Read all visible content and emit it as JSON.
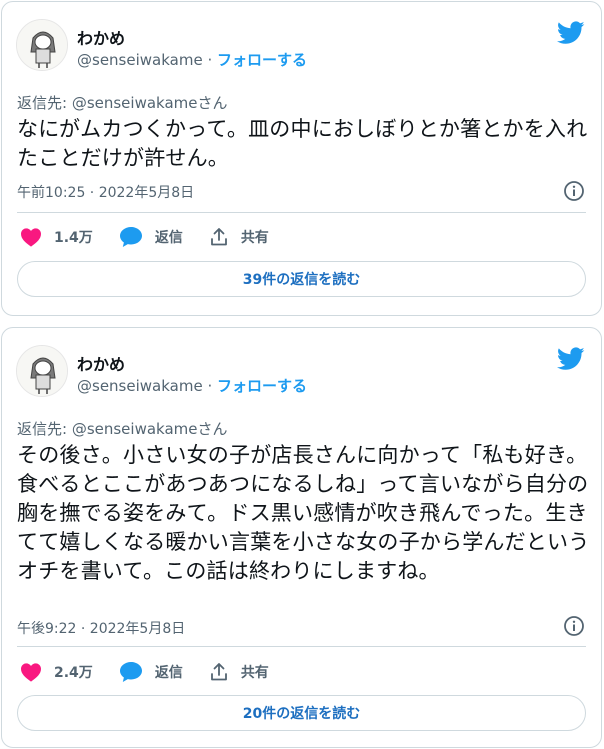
{
  "colors": {
    "accent": "#1d9bf0",
    "like": "#f91880",
    "muted": "#536471"
  },
  "tweets": [
    {
      "name": "わかめ",
      "handle": "@senseiwakame",
      "separator": " · ",
      "follow_label": "フォローする",
      "reply_to": "返信先: @senseiwakameさん",
      "body": "なにがムカつくかって。皿の中におしぼりとか箸とかを入れたことだけが許せん。",
      "timestamp": "午前10:25 · 2022年5月8日",
      "likes": "1.4万",
      "reply_label": "返信",
      "share_label": "共有",
      "read_replies": "39件の返信を読む"
    },
    {
      "name": "わかめ",
      "handle": "@senseiwakame",
      "separator": " · ",
      "follow_label": "フォローする",
      "reply_to": "返信先: @senseiwakameさん",
      "body": "その後さ。小さい女の子が店長さんに向かって「私も好き。食べるとここがあつあつになるしね」って言いながら自分の胸を撫でる姿をみて。ドス黒い感情が吹き飛んでった。生きてて嬉しくなる暖かい言葉を小さな女の子から学んだというオチを書いて。この話は終わりにしますね。",
      "timestamp": "午後9:22 · 2022年5月8日",
      "likes": "2.4万",
      "reply_label": "返信",
      "share_label": "共有",
      "read_replies": "20件の返信を読む"
    }
  ]
}
